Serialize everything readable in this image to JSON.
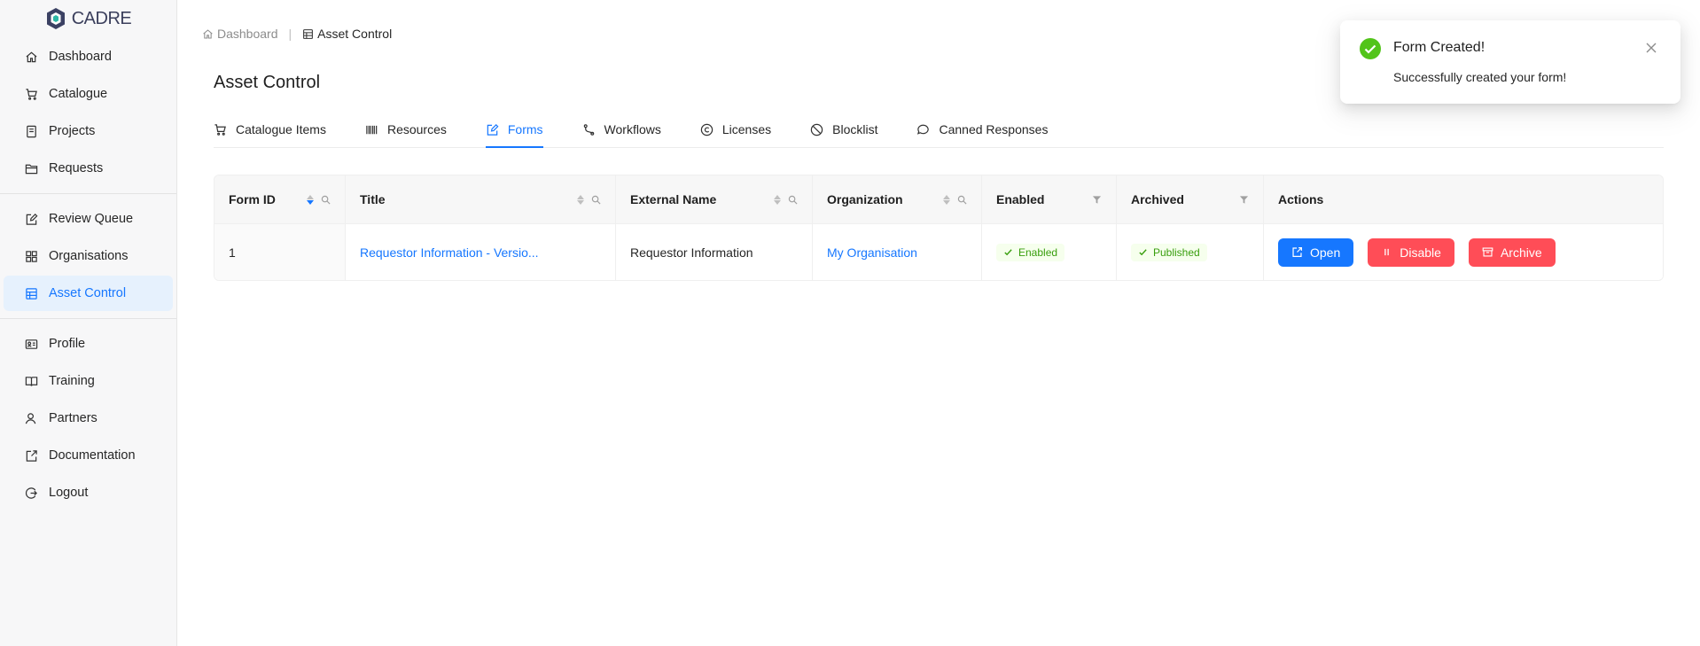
{
  "app": {
    "logo_text": "CADRE"
  },
  "sidebar": {
    "group1": [
      {
        "label": "Dashboard",
        "icon": "home-icon"
      },
      {
        "label": "Catalogue",
        "icon": "cart-icon"
      },
      {
        "label": "Projects",
        "icon": "book-icon"
      },
      {
        "label": "Requests",
        "icon": "folder-icon"
      }
    ],
    "group2": [
      {
        "label": "Review Queue",
        "icon": "edit-icon"
      },
      {
        "label": "Organisations",
        "icon": "appstore-icon"
      },
      {
        "label": "Asset Control",
        "icon": "database-icon",
        "active": true
      }
    ],
    "group3": [
      {
        "label": "Profile",
        "icon": "idcard-icon"
      },
      {
        "label": "Training",
        "icon": "read-icon"
      },
      {
        "label": "Partners",
        "icon": "user-icon"
      },
      {
        "label": "Documentation",
        "icon": "export-icon"
      },
      {
        "label": "Logout",
        "icon": "logout-icon"
      }
    ]
  },
  "breadcrumb": {
    "root": "Dashboard",
    "separator": "|",
    "current": "Asset Control"
  },
  "page": {
    "title": "Asset Control"
  },
  "tabs": [
    {
      "label": "Catalogue Items",
      "icon": "cart-icon"
    },
    {
      "label": "Resources",
      "icon": "barcode-icon"
    },
    {
      "label": "Forms",
      "icon": "form-icon",
      "active": true
    },
    {
      "label": "Workflows",
      "icon": "branches-icon"
    },
    {
      "label": "Licenses",
      "icon": "copyright-icon"
    },
    {
      "label": "Blocklist",
      "icon": "stop-icon"
    },
    {
      "label": "Canned Responses",
      "icon": "message-icon"
    }
  ],
  "table": {
    "columns": {
      "form_id": "Form ID",
      "title": "Title",
      "external_name": "External Name",
      "organization": "Organization",
      "enabled": "Enabled",
      "archived": "Archived",
      "actions": "Actions"
    },
    "rows": [
      {
        "form_id": "1",
        "title": "Requestor Information - Versio...",
        "external_name": "Requestor Information",
        "organization": "My Organisation",
        "enabled": "Enabled",
        "archived": "Published"
      }
    ],
    "actions": {
      "open": "Open",
      "disable": "Disable",
      "archive": "Archive"
    }
  },
  "toast": {
    "title": "Form Created!",
    "message": "Successfully created your form!"
  },
  "colors": {
    "primary": "#1677ff",
    "danger": "#ff4d57",
    "success": "#52c41a",
    "active_bg": "#e6f1fd"
  }
}
